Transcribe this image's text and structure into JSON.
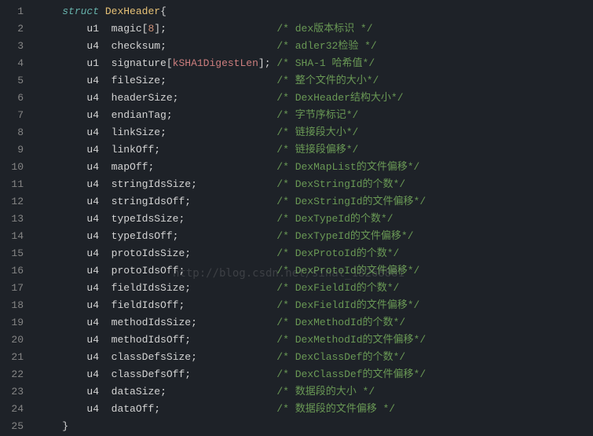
{
  "struct_keyword": "struct",
  "struct_name": "DexHeader",
  "open_brace": "{",
  "close_brace": "}",
  "array_size": "8",
  "const_name": "kSHA1DigestLen",
  "watermark": "http://blog.csdn.net/sinat_18268881",
  "lines": [
    {
      "n": "1"
    },
    {
      "n": "2",
      "type": "u1",
      "field": "magic",
      "arr": true,
      "comment": "/* dex版本标识 */"
    },
    {
      "n": "3",
      "type": "u4",
      "field": "checksum",
      "comment": "/* adler32检验 */"
    },
    {
      "n": "4",
      "type": "u1",
      "field": "signature",
      "arrc": true,
      "comment": "/* SHA-1 哈希值*/"
    },
    {
      "n": "5",
      "type": "u4",
      "field": "fileSize",
      "comment": "/* 整个文件的大小*/"
    },
    {
      "n": "6",
      "type": "u4",
      "field": "headerSize",
      "comment": "/* DexHeader结构大小*/"
    },
    {
      "n": "7",
      "type": "u4",
      "field": "endianTag",
      "comment": "/* 字节序标记*/"
    },
    {
      "n": "8",
      "type": "u4",
      "field": "linkSize",
      "comment": "/* 链接段大小*/"
    },
    {
      "n": "9",
      "type": "u4",
      "field": "linkOff",
      "comment": "/* 链接段偏移*/"
    },
    {
      "n": "10",
      "type": "u4",
      "field": "mapOff",
      "comment": "/* DexMapList的文件偏移*/"
    },
    {
      "n": "11",
      "type": "u4",
      "field": "stringIdsSize",
      "comment": "/* DexStringId的个数*/"
    },
    {
      "n": "12",
      "type": "u4",
      "field": "stringIdsOff",
      "comment": "/* DexStringId的文件偏移*/"
    },
    {
      "n": "13",
      "type": "u4",
      "field": "typeIdsSize",
      "comment": "/* DexTypeId的个数*/"
    },
    {
      "n": "14",
      "type": "u4",
      "field": "typeIdsOff",
      "comment": "/* DexTypeId的文件偏移*/"
    },
    {
      "n": "15",
      "type": "u4",
      "field": "protoIdsSize",
      "comment": "/* DexProtoId的个数*/"
    },
    {
      "n": "16",
      "type": "u4",
      "field": "protoIdsOff",
      "comment": "/* DexProtoId的文件偏移*/"
    },
    {
      "n": "17",
      "type": "u4",
      "field": "fieldIdsSize",
      "comment": "/* DexFieldId的个数*/"
    },
    {
      "n": "18",
      "type": "u4",
      "field": "fieldIdsOff",
      "comment": "/* DexFieldId的文件偏移*/"
    },
    {
      "n": "19",
      "type": "u4",
      "field": "methodIdsSize",
      "comment": "/* DexMethodId的个数*/"
    },
    {
      "n": "20",
      "type": "u4",
      "field": "methodIdsOff",
      "comment": "/* DexMethodId的文件偏移*/"
    },
    {
      "n": "21",
      "type": "u4",
      "field": "classDefsSize",
      "comment": "/* DexClassDef的个数*/"
    },
    {
      "n": "22",
      "type": "u4",
      "field": "classDefsOff",
      "comment": "/* DexClassDef的文件偏移*/"
    },
    {
      "n": "23",
      "type": "u4",
      "field": "dataSize",
      "comment": "/* 数据段的大小 */"
    },
    {
      "n": "24",
      "type": "u4",
      "field": "dataOff",
      "comment": "/* 数据段的文件偏移 */"
    },
    {
      "n": "25"
    }
  ]
}
